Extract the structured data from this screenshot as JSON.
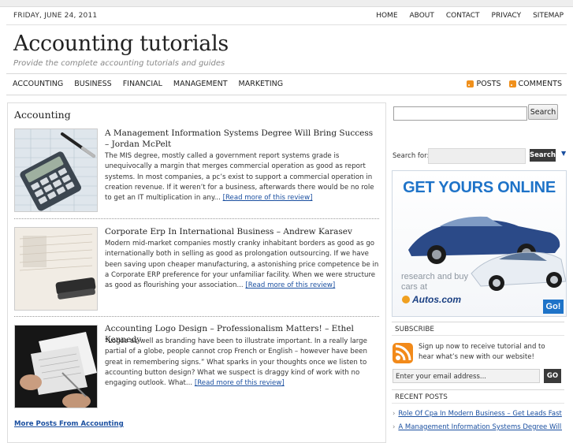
{
  "topbar": {
    "date": "FRIDAY, JUNE 24, 2011",
    "nav": [
      "HOME",
      "ABOUT",
      "CONTACT",
      "PRIVACY",
      "SITEMAP"
    ]
  },
  "site": {
    "title": "Accounting tutorials",
    "tagline": "Provide the complete accounting tutorials and guides"
  },
  "catnav": [
    "ACCOUNTING",
    "BUSINESS",
    "FINANCIAL",
    "MANAGEMENT",
    "MARKETING"
  ],
  "feeds": {
    "posts": "POSTS",
    "comments": "COMMENTS"
  },
  "main": {
    "heading": "Accounting",
    "posts": [
      {
        "title": "A Management Information Systems Degree Will Bring Success – Jordan McPelt",
        "excerpt": "The MIS degree, mostly called a government report systems grade is unequivocally a margin that merges commercial operation as good as report systems. In most companies, a pc’s exist to support a commercial operation in creation revenue. If it weren’t for a business, afterwards there would be no role to get an IT multiplication in any...",
        "read_more": "[Read more of this review]"
      },
      {
        "title": "Corporate Erp In International Business – Andrew Karasev",
        "excerpt": "Modern mid-market companies mostly cranky inhabitant borders as good as go internationally both in selling as good as prolongation outsourcing. If we have been saving upon cheaper manufacturing, a astonishing price competence be in a Corporate ERP preference for your unfamiliar facility. When we were structure as good as flourishing your association...",
        "read_more": "[Read more of this review]"
      },
      {
        "title": "Accounting Logo Design – Professionalism Matters! – Ethel Kennedy",
        "excerpt": "“Logos as well as branding have been to illustrate important. In a really large partial of a globe, people cannot crop French or English – however have been great in remembering signs.” What sparks in your thoughts once we listen to accounting button design? What we suspect is draggy kind of work with no engaging outlook. What...",
        "read_more": "[Read more of this review]"
      }
    ],
    "more_posts": "More Posts From Accounting"
  },
  "sidebar": {
    "search_button": "Search",
    "search_label": "Search for:",
    "search_button2": "Search",
    "tick": "▼",
    "ad": {
      "headline": "GET YOURS ONLINE",
      "sub": "research and buy cars at",
      "brand": "Autos.com",
      "go": "Go!"
    },
    "subscribe": {
      "heading": "SUBSCRIBE",
      "text": "Sign up now to receive tutorial and to hear what’s new with our website!",
      "email_value": "Enter your email address...",
      "go": "GO"
    },
    "recent": {
      "heading": "RECENT POSTS",
      "items": [
        "Role Of Cpa In Modern Business – Get Leads Fast",
        "A Management Information Systems Degree Will Bring Success"
      ]
    }
  },
  "colors": {
    "link": "#1a4fa0",
    "ad_blue": "#1e73c8",
    "rss_orange": "#f0901c"
  },
  "icons": [
    "rss-icon",
    "calculator-photo",
    "stapler-photo",
    "documents-photo",
    "cars-photo",
    "rss-feed-icon"
  ]
}
